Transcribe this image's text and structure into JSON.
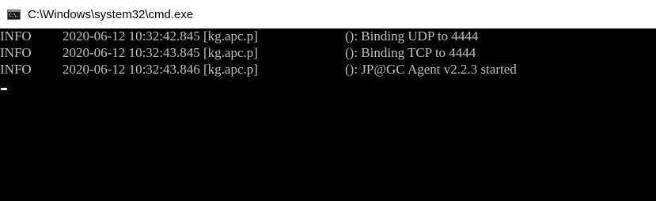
{
  "window": {
    "title": "C:\\Windows\\system32\\cmd.exe",
    "icon": "cmd-icon",
    "icon_text": "C:\\."
  },
  "console": {
    "lines": [
      {
        "level": "INFO",
        "stamp": "2020-06-12 10:32:42.845 [kg.apc.p]",
        "message": "(): Binding UDP to 4444"
      },
      {
        "level": "INFO",
        "stamp": "2020-06-12 10:32:43.845 [kg.apc.p]",
        "message": "(): Binding TCP to 4444"
      },
      {
        "level": "INFO",
        "stamp": "2020-06-12 10:32:43.846 [kg.apc.p]",
        "message": "(): JP@GC Agent v2.2.3 started"
      }
    ]
  },
  "colors": {
    "console_bg": "#000000",
    "console_text": "#c0c0c0",
    "titlebar_bg": "#ffffff"
  }
}
